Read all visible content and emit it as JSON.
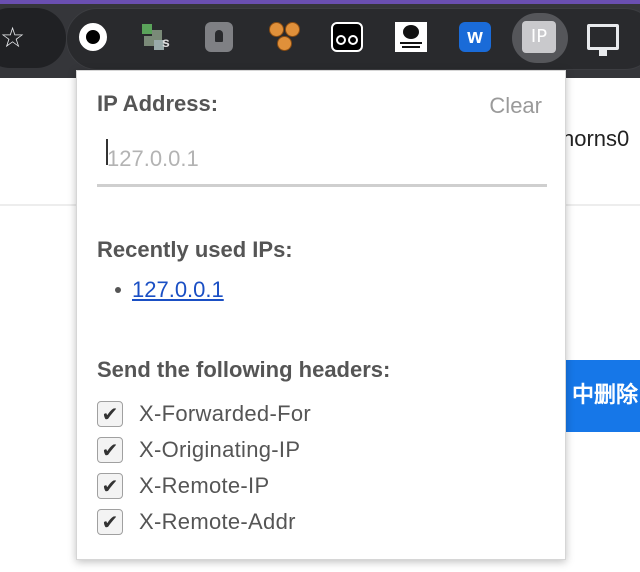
{
  "toolbar": {
    "bookmark_icon": "star-icon",
    "extensions": [
      {
        "name": "ring-extension-icon"
      },
      {
        "name": "puzzle-s-extension-icon",
        "badge": "s"
      },
      {
        "name": "keyhole-extension-icon"
      },
      {
        "name": "cookie-extension-icon"
      },
      {
        "name": "eyes-extension-icon"
      },
      {
        "name": "panda-meme-extension-icon"
      },
      {
        "name": "w-extension-icon",
        "label": "w"
      },
      {
        "name": "ip-extension-icon",
        "label": "IP",
        "active": true
      },
      {
        "name": "monitor-extension-icon"
      }
    ]
  },
  "page": {
    "username_fragment": "norns0",
    "blue_button_fragment": "中删除"
  },
  "popup": {
    "ip_label": "IP Address:",
    "clear_label": "Clear",
    "ip_input": {
      "value": "",
      "placeholder": "127.0.0.1"
    },
    "recent_label": "Recently used IPs:",
    "recent_ips": [
      "127.0.0.1"
    ],
    "headers_label": "Send the following headers:",
    "headers": [
      {
        "label": "X-Forwarded-For",
        "checked": true
      },
      {
        "label": "X-Originating-IP",
        "checked": true
      },
      {
        "label": "X-Remote-IP",
        "checked": true
      },
      {
        "label": "X-Remote-Addr",
        "checked": true
      }
    ]
  },
  "colors": {
    "toolbar_bg": "#35363a",
    "link": "#1a4fc4",
    "page_button": "#1677e8",
    "heading_text": "#555555"
  }
}
